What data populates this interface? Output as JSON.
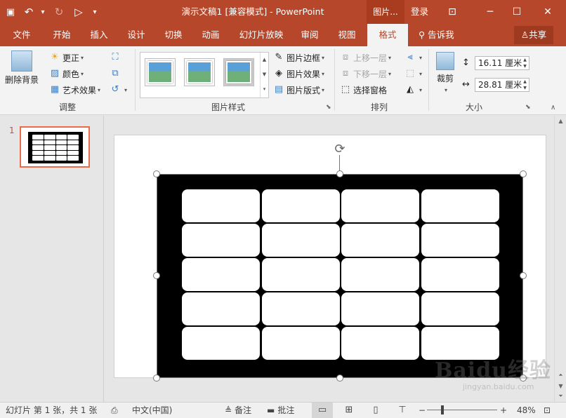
{
  "titlebar": {
    "title": "演示文稿1 [兼容模式] - PowerPoint",
    "context_tab": "图片...",
    "login": "登录",
    "save_icon": "💾",
    "undo_icon": "↶",
    "redo_icon": "↻",
    "present_icon": "▷",
    "customize_icon": "▾",
    "ribbon_display_icon": "⊡",
    "minimize_icon": "─",
    "maximize_icon": "☐",
    "close_icon": "✕"
  },
  "tabs": [
    {
      "label": "文件"
    },
    {
      "label": "开始"
    },
    {
      "label": "插入"
    },
    {
      "label": "设计"
    },
    {
      "label": "切换"
    },
    {
      "label": "动画"
    },
    {
      "label": "幻灯片放映"
    },
    {
      "label": "审阅"
    },
    {
      "label": "视图"
    },
    {
      "label": "格式"
    }
  ],
  "tell_me": "告诉我",
  "share": "共享",
  "ribbon": {
    "adjust": {
      "remove_bg": "删除背景",
      "corrections": "更正",
      "color": "颜色",
      "artistic": "艺术效果",
      "label": "调整"
    },
    "styles": {
      "border": "图片边框",
      "effects": "图片效果",
      "layout": "图片版式",
      "label": "图片样式"
    },
    "arrange": {
      "bring_forward": "上移一层",
      "send_backward": "下移一层",
      "selection_pane": "选择窗格",
      "label": "排列"
    },
    "size": {
      "crop": "裁剪",
      "height": "16.11 厘米",
      "width": "28.81 厘米",
      "label": "大小"
    }
  },
  "thumbnail": {
    "number": "1"
  },
  "watermark": {
    "main": "Baidu经验",
    "sub": "jingyan.baidu.com"
  },
  "statusbar": {
    "slide_info": "幻灯片 第 1 张，共 1 张",
    "language": "中文(中国)",
    "notes": "备注",
    "comments": "批注",
    "zoom": "48%"
  }
}
